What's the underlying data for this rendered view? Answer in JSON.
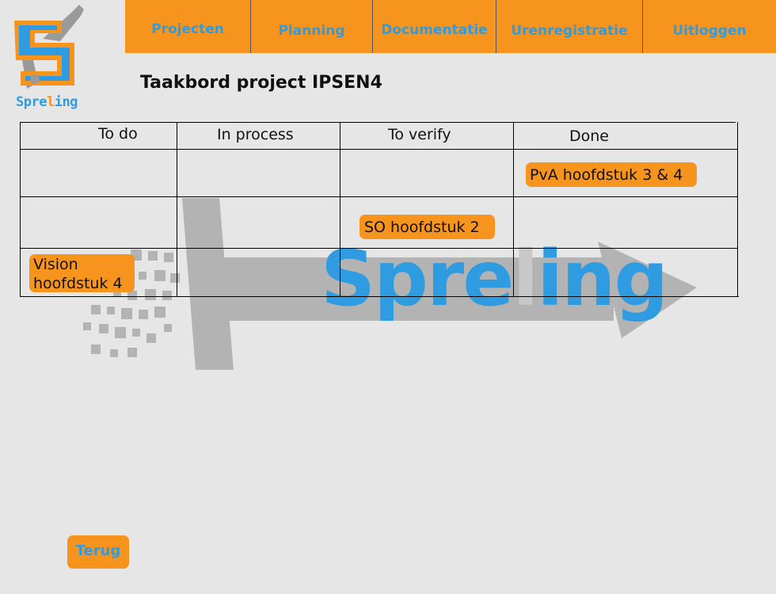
{
  "brand": {
    "logo_text_pre": "Spre",
    "logo_text_accent": "l",
    "logo_text_post": "ing",
    "watermark_pre": "Spre",
    "watermark_accent": "l",
    "watermark_post": "ing",
    "colors": {
      "accent": "#f7941d",
      "brand_blue": "#2f9be0",
      "background": "#e6e6e6",
      "watermark_gray": "#b3b3b3"
    }
  },
  "nav": {
    "items": [
      {
        "label": "Projecten"
      },
      {
        "label": "Planning"
      },
      {
        "label": "Documentatie"
      },
      {
        "label": "Urenregistratie"
      },
      {
        "label": "Uitloggen"
      }
    ]
  },
  "page": {
    "title": "Taakbord project IPSEN4"
  },
  "board": {
    "columns": [
      {
        "label": "To do"
      },
      {
        "label": "In process"
      },
      {
        "label": "To verify"
      },
      {
        "label": "Done"
      }
    ],
    "cards": [
      {
        "label": "PvA hoofdstuk 3 & 4",
        "column": "Done",
        "row": 1
      },
      {
        "label": "SO hoofdstuk 2",
        "column": "To verify",
        "row": 2
      },
      {
        "label": "Vision hoofdstuk 4",
        "column": "To do",
        "row": 3
      }
    ]
  },
  "footer": {
    "back_label": "Terug"
  }
}
